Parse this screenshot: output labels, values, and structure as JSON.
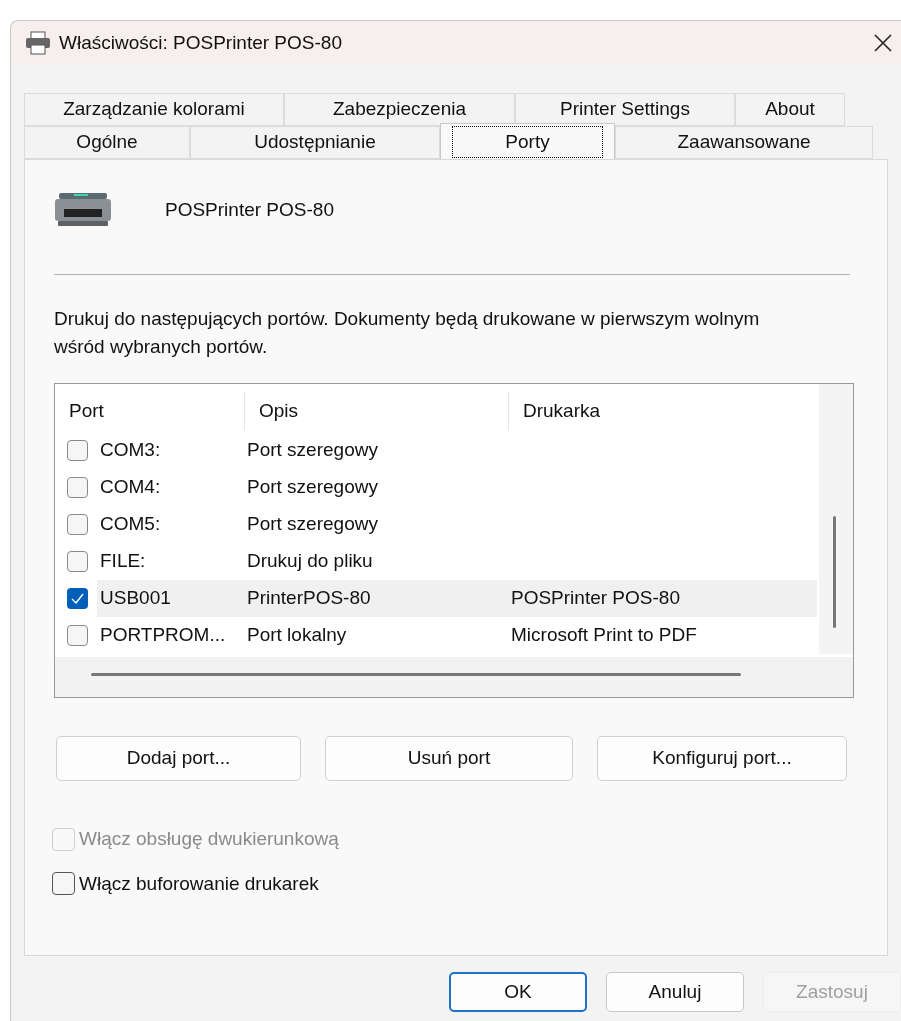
{
  "window": {
    "title": "Właściwości: POSPrinter POS-80"
  },
  "tab_rows": [
    [
      {
        "label": "Zarządzanie kolorami",
        "selected": false
      },
      {
        "label": "Zabezpieczenia",
        "selected": false
      },
      {
        "label": "Printer Settings",
        "selected": false
      },
      {
        "label": "About",
        "selected": false
      }
    ],
    [
      {
        "label": "Ogólne",
        "selected": false
      },
      {
        "label": "Udostępnianie",
        "selected": false
      },
      {
        "label": "Porty",
        "selected": true
      },
      {
        "label": "Zaawansowane",
        "selected": false
      }
    ]
  ],
  "printer_name": "POSPrinter POS-80",
  "description": "Drukuj do następujących portów. Dokumenty będą drukowane w pierwszym wolnym wśród wybranych portów.",
  "ports_table": {
    "columns": [
      "Port",
      "Opis",
      "Drukarka"
    ],
    "rows": [
      {
        "port": "COM3:",
        "description": "Port szeregowy",
        "checked": false,
        "selected": false
      },
      {
        "port": "COM4:",
        "description": "Port szeregowy",
        "checked": false,
        "selected": false
      },
      {
        "port": "COM5:",
        "description": "Port szeregowy",
        "checked": false,
        "selected": false
      },
      {
        "port": "FILE:",
        "description": "Drukuj do pliku",
        "checked": false,
        "selected": false
      },
      {
        "port": "USB001",
        "description": "PrinterPOS-80",
        "printer": "POSPrinter POS-80",
        "checked": true,
        "selected": true
      },
      {
        "port": "PORTPROM...",
        "description": "Port lokalny",
        "printer": "Microsoft Print to PDF",
        "checked": false,
        "selected": false
      }
    ]
  },
  "port_buttons": [
    "Dodaj port...",
    "Usuń port",
    "Konfiguruj port..."
  ],
  "options": [
    {
      "label": "Włącz obsługę dwukierunkową",
      "checked": false,
      "disabled": true
    },
    {
      "label": "Włącz buforowanie drukarek",
      "checked": false,
      "disabled": false
    }
  ],
  "dialog_buttons": [
    {
      "label": "OK",
      "default": true,
      "disabled": false
    },
    {
      "label": "Anuluj",
      "default": false,
      "disabled": false
    },
    {
      "label": "Zastosuj",
      "default": false,
      "disabled": true
    }
  ]
}
